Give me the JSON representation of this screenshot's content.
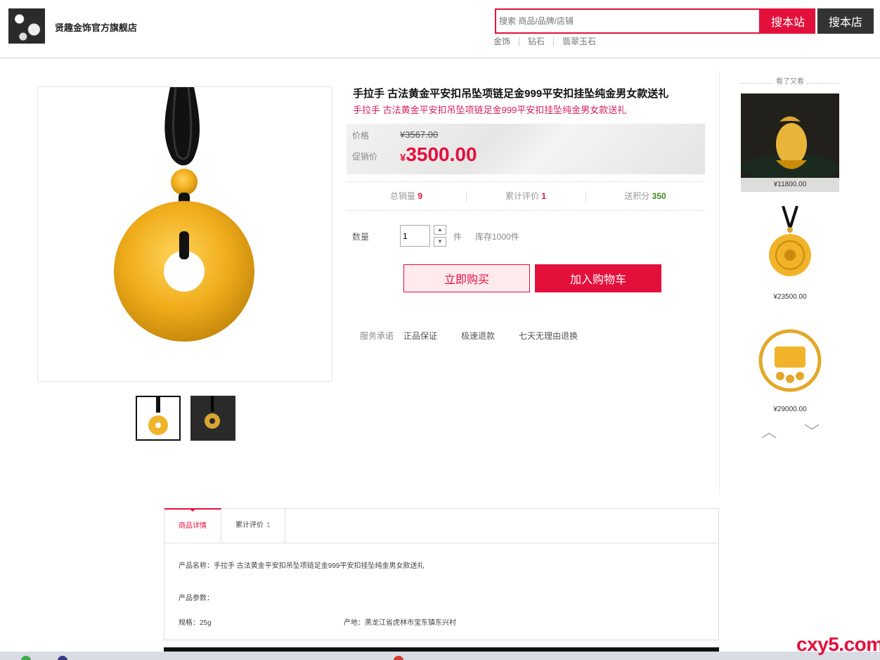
{
  "header": {
    "store_name": "贤趣金饰官方旗舰店",
    "search_placeholder": "搜索 商品/品牌/店铺",
    "search_site_label": "搜本站",
    "search_store_label": "搜本店",
    "hot_links": [
      "金饰",
      "钻石",
      "翡翠玉石"
    ]
  },
  "product": {
    "title": "手拉手 古法黄金平安扣吊坠项链足金999平安扣挂坠纯金男女款送礼",
    "subtitle": "手拉手 古法黄金平安扣吊坠项链足金999平安扣挂坠纯金男女款送礼",
    "price_label": "价格",
    "price_old": "¥3567.00",
    "promo_label": "促销价",
    "promo_currency": "¥",
    "promo_price": "3500.00",
    "stats": {
      "sales_label": "总销量",
      "sales_value": "9",
      "reviews_label": "累计评价",
      "reviews_value": "1",
      "points_label": "送积分",
      "points_value": "350"
    },
    "quantity_label": "数量",
    "quantity_value": "1",
    "quantity_unit": "件",
    "stock": "库存1000件",
    "buy_now_label": "立即购买",
    "add_cart_label": "加入购物车",
    "service_label": "服务承诺",
    "services": [
      "正品保证",
      "极速退款",
      "七天无理由退换"
    ]
  },
  "also_viewed": {
    "heading": "看了又看",
    "items": [
      {
        "price": "¥11800.00"
      },
      {
        "price": "¥23500.00"
      },
      {
        "price": "¥29000.00"
      }
    ]
  },
  "tabs": {
    "details_label": "商品详情",
    "reviews_label": "累计评价",
    "reviews_count": "1"
  },
  "detail": {
    "name_label": "产品名称：",
    "name_value": "手拉手 古法黄金平安扣吊坠项链足金999平安扣挂坠纯金男女款送礼",
    "params_label": "产品参数：",
    "spec_label": "规格：",
    "spec_value": "25g",
    "origin_label": "产地：",
    "origin_value": "黑龙江省虎林市宝东镇东兴村"
  },
  "watermark": "cxy5.com",
  "colors": {
    "accent": "#e4103c",
    "points_green": "#3c8c1e",
    "gold": "#f0b32a"
  }
}
